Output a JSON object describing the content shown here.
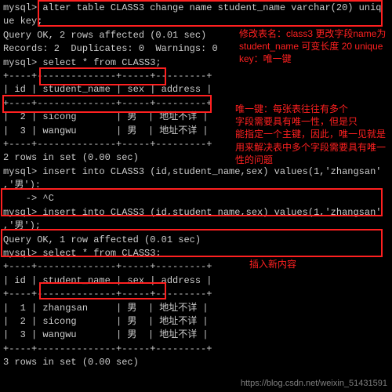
{
  "lines": {
    "l0": "mysql> alter table CLASS3 change name student_name varchar(20) uniq",
    "l1": "ue key;",
    "l2": "Query OK, 2 rows affected (0.01 sec)",
    "l3": "Records: 2  Duplicates: 0  Warnings: 0",
    "l4": "",
    "l5": "mysql> select * from CLASS3;",
    "l6": "+----+--------------+-----+---------+",
    "l7": "| id | student_name | sex | address |",
    "l8": "+----+--------------+-----+---------+",
    "l9": "|  2 | sicong       | 男  | 地址不详 |",
    "l10": "|  3 | wangwu       | 男  | 地址不详 |",
    "l11": "+----+--------------+-----+---------+",
    "l12": "2 rows in set (0.00 sec)",
    "l13": "",
    "l14": "mysql> insert into CLASS3 (id,student_name,sex) values(1,'zhangsan'",
    "l15": ",'男'):",
    "l16": "    -> ^C",
    "l17": "mysql> insert into CLASS3 (id,student_name,sex) values(1,'zhangsan'",
    "l18": ",'男');",
    "l19": "Query OK, 1 row affected (0.01 sec)",
    "l20": "",
    "l21": "mysql> select * from CLASS3;",
    "l22": "+----+--------------+-----+---------+",
    "l23": "| id | student_name | sex | address |",
    "l24": "+----+--------------+-----+---------+",
    "l25": "|  1 | zhangsan     | 男  | 地址不详 |",
    "l26": "|  2 | sicong       | 男  | 地址不详 |",
    "l27": "|  3 | wangwu       | 男  | 地址不详 |",
    "l28": "+----+--------------+-----+---------+",
    "l29": "3 rows in set (0.00 sec)"
  },
  "annotations": {
    "a1": "修改表名：class3 更改字段name为\nstudent_name 可变长度 20 unique\nkey：唯一键",
    "a2": "唯一键：每张表往往有多个\n字段需要具有唯一性，但是只\n能指定一个主键，因此，唯一见就是\n用来解决表中多个字段需要具有唯一\n性的问题",
    "a3": "插入新内容"
  },
  "watermark": "https://blog.csdn.net/weixin_51431591"
}
